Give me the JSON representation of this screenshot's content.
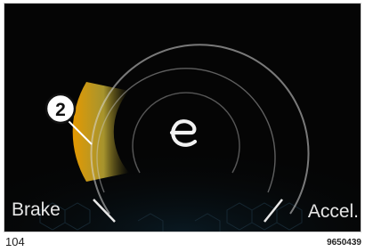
{
  "display": {
    "mode_icon": "eco-e-icon",
    "callout_number": "2",
    "left_label": "Brake",
    "right_label": "Accel.",
    "colors": {
      "brake_gradient_start": "#f0a000",
      "brake_gradient_end": "#c8d040",
      "arc": "#ffffff",
      "background": "#050505"
    }
  },
  "footer": {
    "page_number": "104",
    "figure_code": "9650439"
  }
}
